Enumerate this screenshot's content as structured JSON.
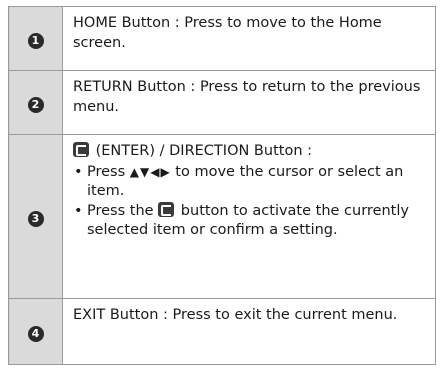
{
  "rows": [
    {
      "number": "1",
      "name": "HOME",
      "separator": " Button : ",
      "text": "Press to move to the Home screen."
    },
    {
      "number": "2",
      "name": "RETURN",
      "separator": " Button : ",
      "text": "Press to return to the previous menu."
    },
    {
      "number": "3",
      "heading_enter": "(ENTER) / DIRECTION",
      "heading_suffix": " Button :",
      "bullet1_pre": "Press ",
      "bullet1_arrows": "▲▼◀▶",
      "bullet1_post": " to move the cursor or select an item.",
      "bullet2_pre": "Press the ",
      "bullet2_post": " button to activate the currently selected item or confirm a setting."
    },
    {
      "number": "4",
      "name": "EXIT",
      "separator": " Button : ",
      "text": "Press to exit the current menu."
    }
  ],
  "icons": {
    "enter": "enter-icon"
  }
}
